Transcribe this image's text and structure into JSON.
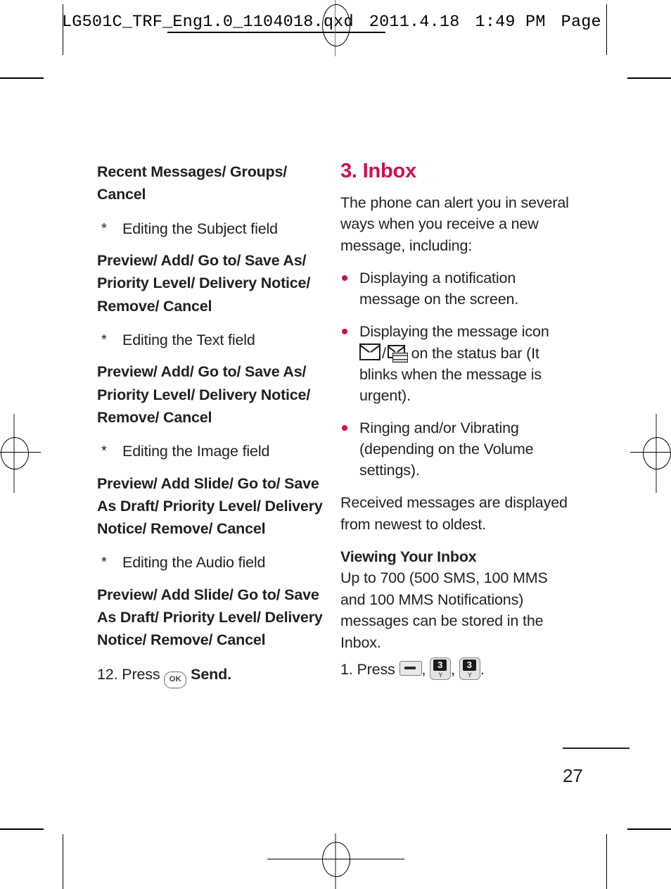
{
  "slug": {
    "filename": "LG501C_TRF_Eng1.0_1104018.qxd",
    "date": "2011.4.18",
    "time": "1:49 PM",
    "page_label": "Page"
  },
  "theme": {
    "accent": "#CE0E4E",
    "text": "#231f20"
  },
  "left_column": {
    "options_1": "Recent Messages/ Groups/ Cancel",
    "star_1_marker": "*",
    "star_1": "Editing the Subject field",
    "options_2": "Preview/ Add/ Go to/ Save As/ Priority Level/ Delivery Notice/ Remove/ Cancel",
    "star_2_marker": "*",
    "star_2": "Editing the Text field",
    "options_3": "Preview/ Add/ Go to/ Save As/ Priority Level/ Delivery Notice/ Remove/ Cancel",
    "star_3_marker": "*",
    "star_3": "Editing the Image field",
    "options_4": "Preview/ Add Slide/ Go to/ Save As Draft/ Priority Level/ Delivery Notice/ Remove/ Cancel",
    "star_4_marker": "*",
    "star_4": "Editing the Audio field",
    "options_5": "Preview/ Add Slide/ Go to/ Save As Draft/ Priority Level/ Delivery Notice/ Remove/ Cancel",
    "step_12_prefix": "12. Press",
    "step_12_key": "OK",
    "step_12_suffix": "Send."
  },
  "right_column": {
    "heading": "3. Inbox",
    "intro": "The phone can alert you in several ways when you receive a new message, including:",
    "bullets": [
      {
        "text": "Displaying a notification message on the screen."
      },
      {
        "text_before": "Displaying the message icon",
        "sms_icon": "sms-envelope-icon",
        "separator": "/",
        "mms_icon": "mms-envelope-icon",
        "text_after": "on the status bar (It blinks when the message is urgent)."
      },
      {
        "text": "Ringing and/or Vibrating (depending on the Volume settings)."
      }
    ],
    "received_note": "Received messages are displayed from newest to oldest.",
    "sub_heading": "Viewing Your Inbox",
    "capacity": "Up to 700 (500 SMS, 100 MMS and 100 MMS Notifications) messages can be stored in the Inbox.",
    "step_1_prefix": "1. Press",
    "step_1_comma": ",",
    "step_1_key_soft": "soft-key-dash",
    "step_1_key_num_1": "3",
    "step_1_key_num_1_sub": "Y",
    "step_1_key_num_2": "3",
    "step_1_key_num_2_sub": "Y",
    "step_1_period": "."
  },
  "folio": {
    "page_number": "27"
  }
}
